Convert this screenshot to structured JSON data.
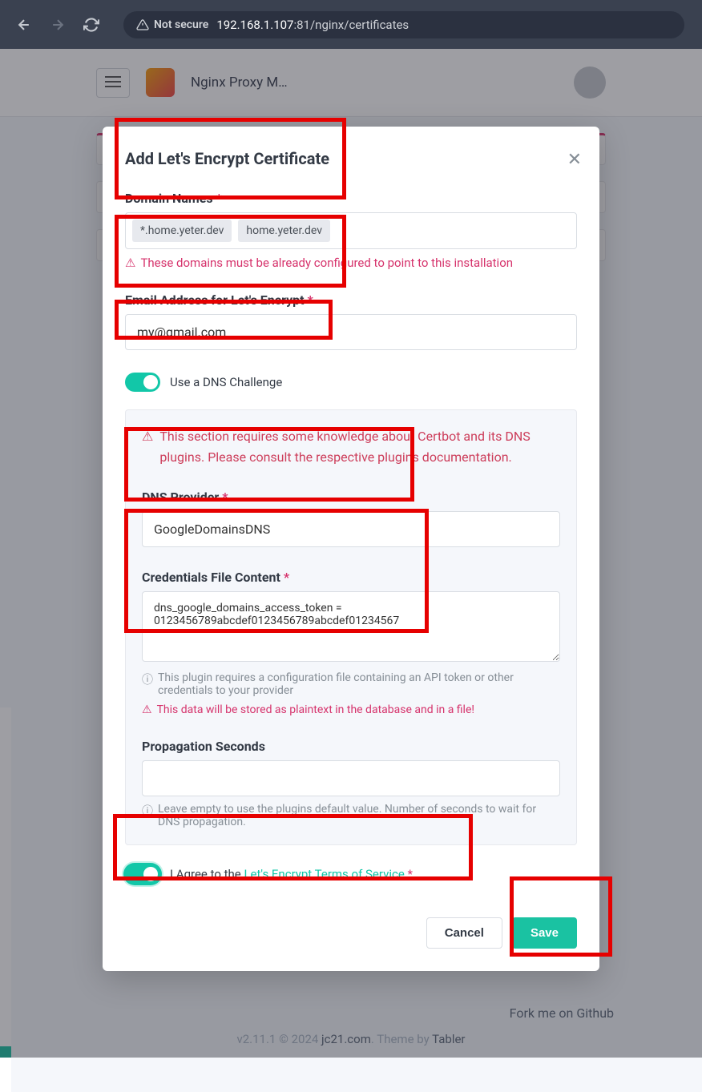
{
  "browser": {
    "not_secure_label": "Not secure",
    "url_host": "192.168.1.107",
    "url_port": ":81",
    "url_path": "/nginx/certificates"
  },
  "bg": {
    "app_title": "Nginx Proxy M…",
    "fork_link": "Fork me on Github",
    "footer_version": "v2.11.1 © 2024 ",
    "footer_link1": "jc21.com",
    "footer_mid": ". Theme by ",
    "footer_link2": "Tabler"
  },
  "modal": {
    "title": "Add Let's Encrypt Certificate",
    "domain_label": "Domain Names",
    "domain_tags": [
      "*.home.yeter.dev",
      "home.yeter.dev"
    ],
    "domain_hint": "These domains must be already configured to point to this installation",
    "email_label": "Email Address for Let's Encrypt",
    "email_value": "my@gmail.com",
    "dns_toggle_label": "Use a DNS Challenge",
    "panel_warn": "This section requires some knowledge about Certbot and its DNS plugins. Please consult the respective plugins documentation.",
    "provider_label": "DNS Provider",
    "provider_value": "GoogleDomainsDNS",
    "creds_label": "Credentials File Content",
    "creds_value": "dns_google_domains_access_token = 0123456789abcdef0123456789abcdef01234567",
    "creds_hint": "This plugin requires a configuration file containing an API token or other credentials to your provider",
    "creds_warn": "This data will be stored as plaintext in the database and in a file!",
    "prop_label": "Propagation Seconds",
    "prop_value": "",
    "prop_hint": "Leave empty to use the plugins default value. Number of seconds to wait for DNS propagation.",
    "agree_prefix": "I Agree to the ",
    "agree_link": "Let's Encrypt Terms of Service",
    "cancel": "Cancel",
    "save": "Save"
  }
}
